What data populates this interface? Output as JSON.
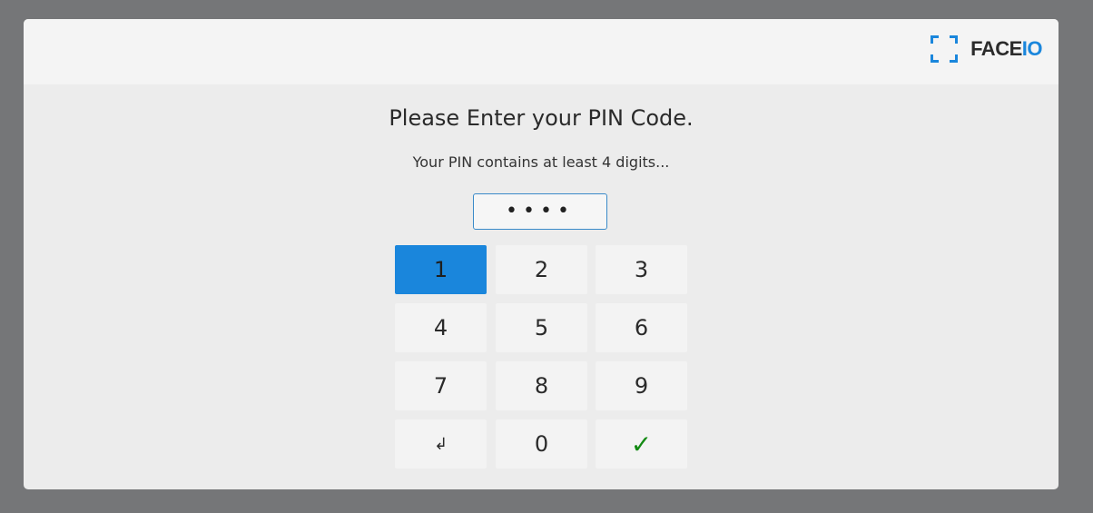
{
  "brand": {
    "name_main": "FACE",
    "name_accent": "IO",
    "accent_color": "#1a86dc"
  },
  "dialog": {
    "title": "Please Enter your PIN Code.",
    "subtitle": "Your PIN contains at least 4 digits...",
    "pin_value": "••••"
  },
  "keypad": {
    "k1": "1",
    "k2": "2",
    "k3": "3",
    "k4": "4",
    "k5": "5",
    "k6": "6",
    "k7": "7",
    "k8": "8",
    "k9": "9",
    "back": "↲",
    "k0": "0",
    "confirm": "✓"
  },
  "colors": {
    "active_key": "#1a86dc",
    "confirm_icon": "#138a13",
    "overlay": "#757678"
  },
  "icons": {
    "brand": "face-frame-icon",
    "back": "return-arrow-icon",
    "confirm": "checkmark-icon"
  }
}
